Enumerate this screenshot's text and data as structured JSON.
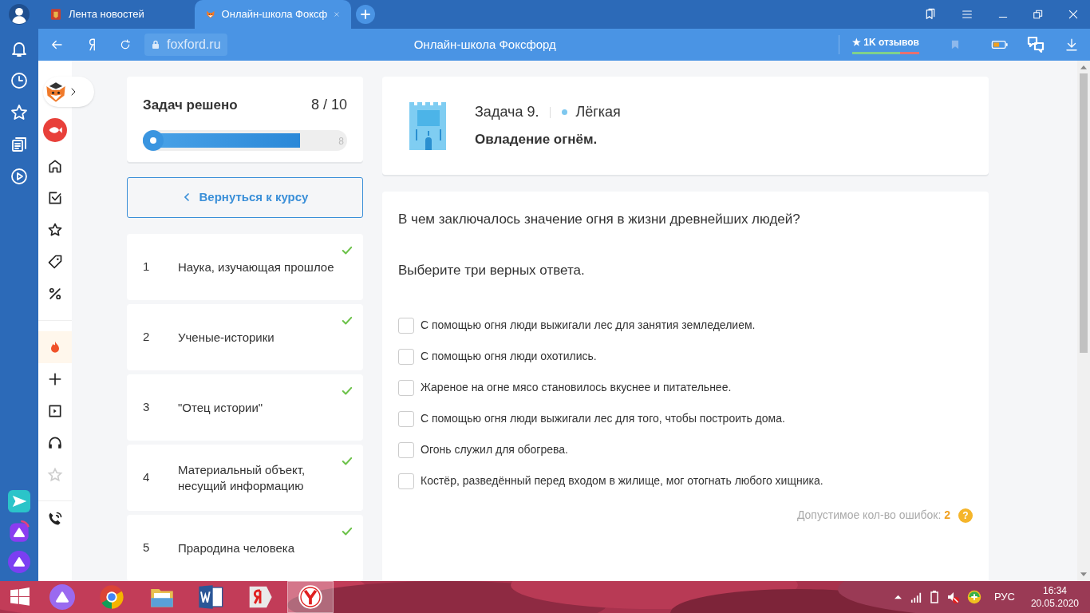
{
  "browser": {
    "tabs": [
      {
        "title": "Лента новостей",
        "selected": false
      },
      {
        "title": "Онлайн-школа Фоксф",
        "selected": true
      }
    ],
    "address": "foxford.ru",
    "page_title": "Онлайн-школа Фоксфорд",
    "reviews": "★ 1K отзывов"
  },
  "site_nav": [
    {
      "kind": "home",
      "selected": false
    },
    {
      "kind": "tasks",
      "selected": false
    },
    {
      "kind": "star",
      "selected": false
    },
    {
      "kind": "tag",
      "selected": false
    },
    {
      "kind": "percent",
      "selected": false
    },
    {
      "kind": "fire",
      "selected": true
    },
    {
      "kind": "plus",
      "selected": false
    },
    {
      "kind": "video",
      "selected": false
    },
    {
      "kind": "headphones",
      "selected": false
    },
    {
      "kind": "star-outline",
      "selected": false
    }
  ],
  "progress": {
    "title": "Задач решено",
    "count": "8 / 10",
    "level": 0.77,
    "marker": "8"
  },
  "back_button": "Вернуться к курсу",
  "tasks": [
    {
      "number": "1",
      "title": "Наука, изучающая прошлое",
      "done": true
    },
    {
      "number": "2",
      "title": "Ученые-историки",
      "done": true
    },
    {
      "number": "3",
      "title": "\"Отец истории\"",
      "done": true
    },
    {
      "number": "4",
      "title": "Материальный объект, несущий информацию",
      "done": true
    },
    {
      "number": "5",
      "title": "Прародина человека",
      "done": true
    }
  ],
  "task": {
    "number": "Задача 9.",
    "difficulty": "Лёгкая",
    "title": "Овладение огнём."
  },
  "question": "В чем заключалось значение огня в жизни древнейших людей?",
  "instruction": "Выберите три верных ответа.",
  "options": [
    {
      "text": "С помощью огня люди выжигали лес для занятия земледелием.",
      "checked": false
    },
    {
      "text": "С помощью огня люди охотились.",
      "checked": false
    },
    {
      "text": "Жареное на огне мясо становилось вкуснее и питательнее.",
      "checked": false
    },
    {
      "text": "С помощью огня люди выжигали лес для того, чтобы построить дома.",
      "checked": false
    },
    {
      "text": "Огонь служил для обогрева.",
      "checked": false
    },
    {
      "text": "Костёр, разведённый перед входом в жилище, мог отогнать любого хищника.",
      "checked": false
    }
  ],
  "errors": {
    "label": "Допустимое кол-во ошибок:",
    "value": "2",
    "help": "?"
  },
  "taskbar": {
    "language": "РУС",
    "time": "16:34",
    "date": "20.05.2020"
  }
}
